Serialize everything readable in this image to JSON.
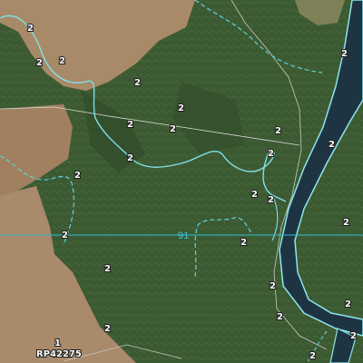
{
  "map": {
    "colors": {
      "vegetation": "#3c5a32",
      "vegetation_dark": "#2f4a2a",
      "cleared_land": "#a88a68",
      "river_fill": "#1f3442",
      "river_outline": "#8be6ee",
      "drainage_line": "#5fd3dd",
      "grid_line": "#27b9d0",
      "track": "#c8c8c8",
      "boundary": "#e8e8e8"
    },
    "grid_label": "91",
    "lot_number": "1",
    "plan_label": "RP42275",
    "stream_order_labels": [
      "2",
      "2",
      "2",
      "2",
      "2",
      "2",
      "2",
      "2",
      "2",
      "2",
      "2",
      "2",
      "2",
      "2",
      "2",
      "2",
      "2",
      "2",
      "2",
      "2",
      "2",
      "2",
      "2",
      "2",
      "2"
    ]
  }
}
